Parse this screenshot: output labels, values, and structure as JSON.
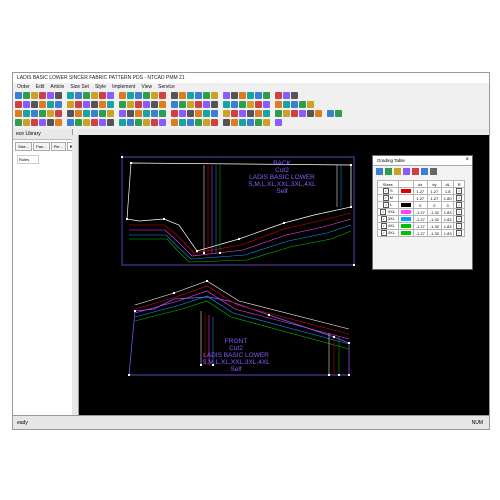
{
  "window": {
    "title": "LADIS BASIC LOWER  SINCER FABRIC PATTERN PDS - NTCAD PMM 21"
  },
  "menu": [
    "Order",
    "Edit",
    "Article",
    "Size Set",
    "Style",
    "Implement",
    "View",
    "Service"
  ],
  "side_panel": {
    "title": "ece Library",
    "tabs": [
      "Size...",
      "Pan...",
      "Pie...",
      "Rules"
    ],
    "active_tab": "Rules",
    "rules_label": "Rules"
  },
  "status": {
    "left": "eady",
    "right": "NUM"
  },
  "pieces": {
    "back": {
      "lines": [
        "BACK",
        "Cut2",
        "LADIS BASIC LOWER",
        "S,M,L,XL,XXL,3XL,4XL",
        "Self"
      ]
    },
    "front": {
      "lines": [
        "FRONT",
        "Cut2",
        "LADIS BASIC LOWER",
        "S,M,L,XL,XXL,3XL,4XL",
        "Self"
      ]
    }
  },
  "grading_table": {
    "title": "Grading Table",
    "headers": [
      "Sizes",
      "dx",
      "dy",
      "dL",
      "R"
    ],
    "rows": [
      {
        "size": "S",
        "color": "#e60000",
        "dx": "1.27",
        "dy": "1.27",
        "dl": "1.8"
      },
      {
        "size": "M",
        "color": "#ffffff",
        "dx": "1.27",
        "dy": "1.27",
        "dl": "1.80"
      },
      {
        "size": "L",
        "color": "#000000",
        "dx": "0",
        "dy": "0",
        "dl": "0"
      },
      {
        "size": "XXL",
        "color": "#ff40ff",
        "dx": "-1.27",
        "dy": "-1.32",
        "dl": "1.83"
      },
      {
        "size": "3XL",
        "color": "#00a0ff",
        "dx": "-1.27",
        "dy": "-1.32",
        "dl": "1.83"
      },
      {
        "size": "4XL",
        "color": "#00c000",
        "dx": "-1.27",
        "dy": "-1.32",
        "dl": "1.83"
      },
      {
        "size": "4XL",
        "color": "#00c000",
        "dx": "-1.27",
        "dy": "-1.32",
        "dl": "1.83"
      }
    ]
  },
  "colors": {
    "canvas": "#000000",
    "outline": "#8a5cff",
    "text": "#8a5cff"
  }
}
